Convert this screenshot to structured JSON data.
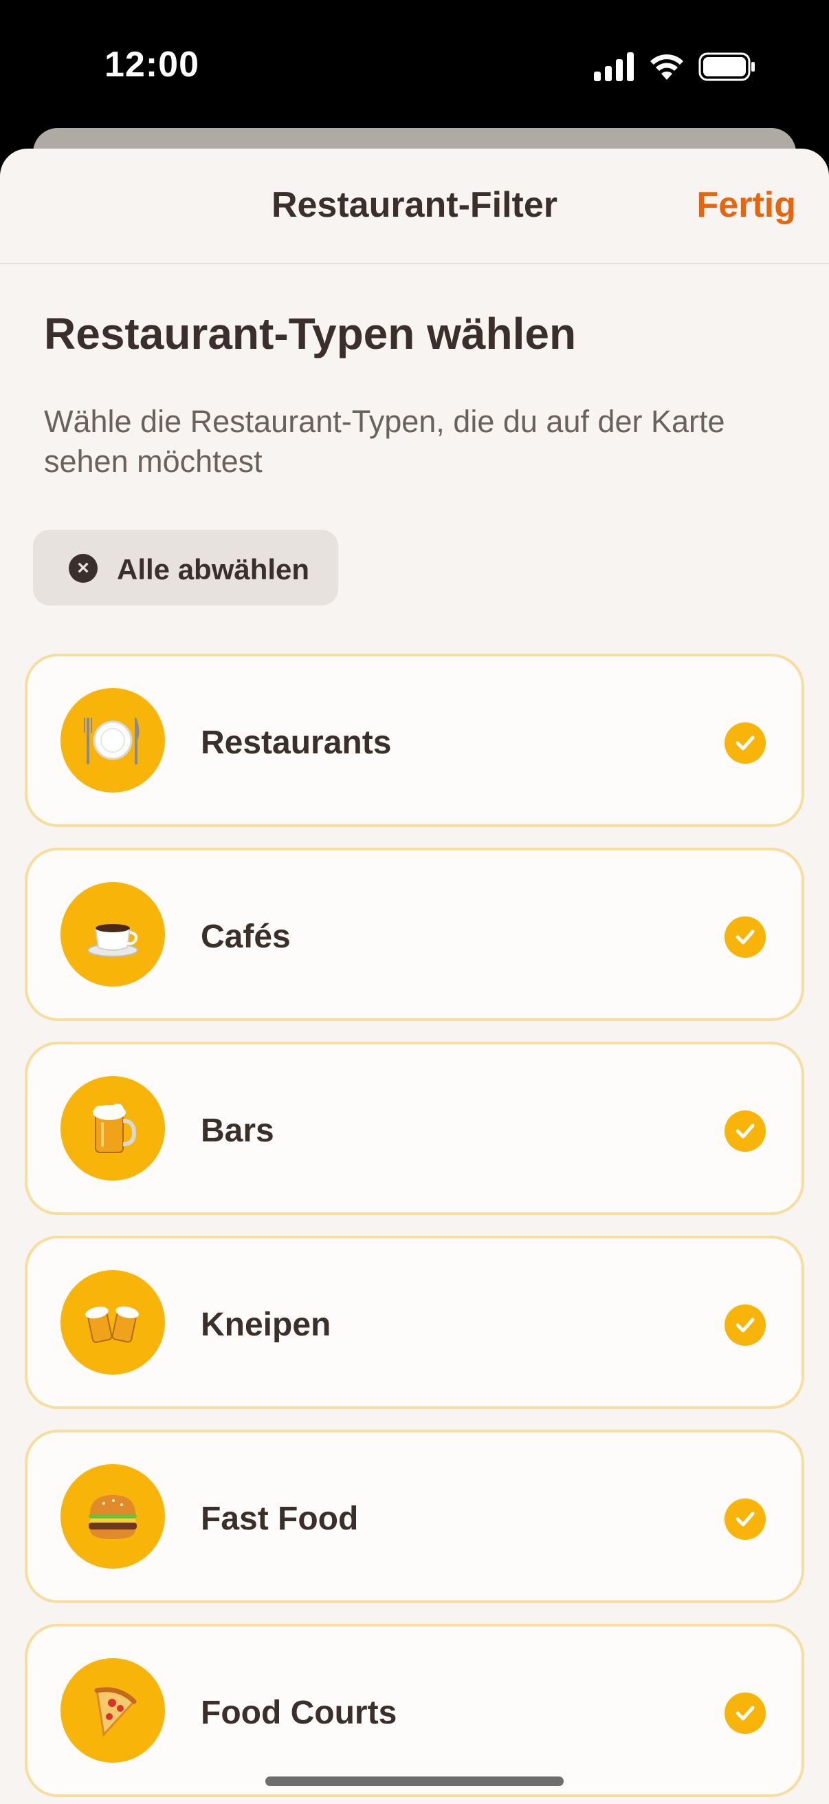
{
  "status_bar": {
    "time": "12:00"
  },
  "nav": {
    "title": "Restaurant-Filter",
    "done_label": "Fertig"
  },
  "section": {
    "title": "Restaurant-Typen wählen",
    "subtitle": "Wähle die Restaurant-Typen, die du auf der Karte sehen möchtest"
  },
  "deselect_button": {
    "label": "Alle abwählen",
    "icon": "close-circle-icon"
  },
  "categories": [
    {
      "label": "Restaurants",
      "icon": "plate-cutlery-icon",
      "selected": true
    },
    {
      "label": "Cafés",
      "icon": "coffee-cup-icon",
      "selected": true
    },
    {
      "label": "Bars",
      "icon": "beer-mug-icon",
      "selected": true
    },
    {
      "label": "Kneipen",
      "icon": "clinking-beer-mugs-icon",
      "selected": true
    },
    {
      "label": "Fast Food",
      "icon": "burger-icon",
      "selected": true
    },
    {
      "label": "Food Courts",
      "icon": "pizza-slice-icon",
      "selected": true
    }
  ],
  "colors": {
    "accent": "#e8650c",
    "icon_circle": "#f9b40a",
    "card_border": "#f6dea0",
    "text_primary": "#3b2f2b",
    "background": "#f7f4f1"
  }
}
